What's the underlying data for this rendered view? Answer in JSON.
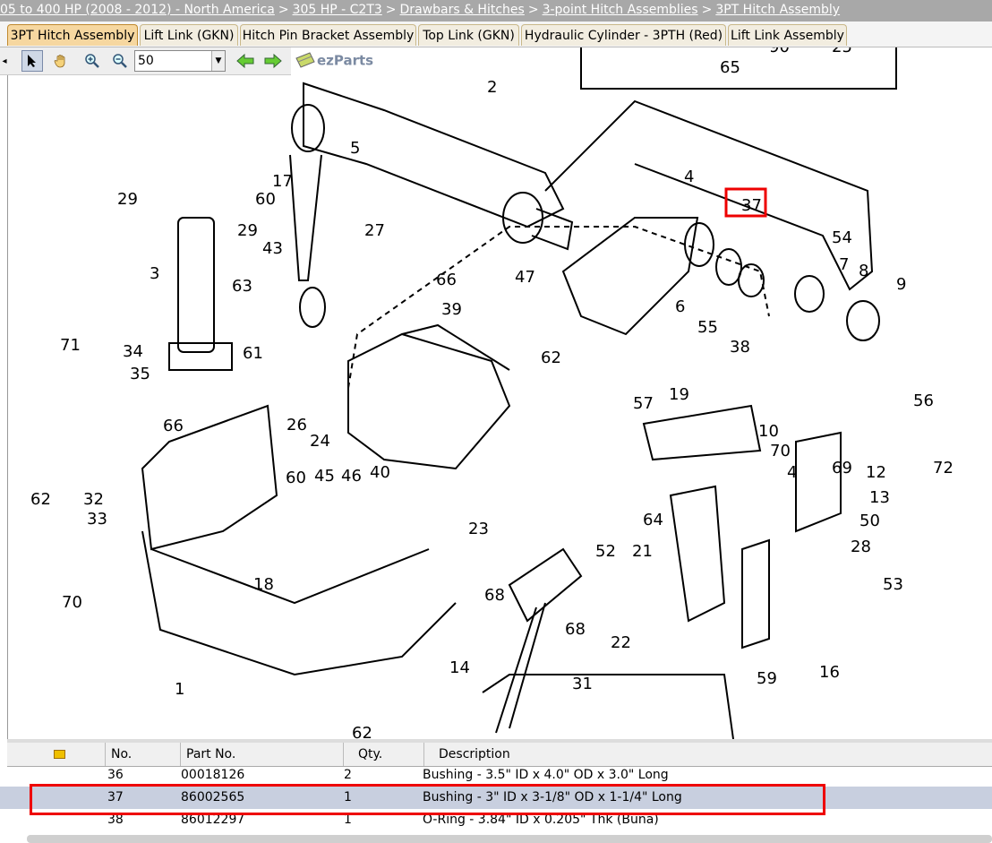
{
  "breadcrumb": [
    "05 to 400 HP (2008 - 2012) - North America",
    "305 HP - C2T3",
    "Drawbars & Hitches",
    "3-point Hitch Assemblies",
    "3PT Hitch Assembly"
  ],
  "breadcrumb_sep": ">",
  "tabs": [
    "3PT Hitch Assembly",
    "Lift Link (GKN)",
    "Hitch Pin Bracket Assembly",
    "Top Link (GKN)",
    "Hydraulic Cylinder - 3PTH (Red)",
    "Lift Link Assembly"
  ],
  "active_tab": "3PT Hitch Assembly",
  "toolbar": {
    "zoom": "50",
    "logo_text": "ezParts"
  },
  "icons": [
    "pointer-icon",
    "pan-hand-icon",
    "zoom-in-icon",
    "zoom-out-icon",
    "back-arrow-icon",
    "forward-arrow-icon",
    "note-icon"
  ],
  "callouts": [
    "65",
    "90",
    "25",
    "2",
    "5",
    "4",
    "37",
    "17",
    "60",
    "29",
    "29",
    "27",
    "43",
    "3",
    "63",
    "66",
    "47",
    "39",
    "54",
    "7",
    "8",
    "9",
    "6",
    "55",
    "38",
    "62",
    "71",
    "34",
    "35",
    "61",
    "26",
    "24",
    "19",
    "10",
    "56",
    "70",
    "4",
    "69",
    "57",
    "72",
    "66",
    "12",
    "13",
    "50",
    "62",
    "32",
    "33",
    "60",
    "45",
    "46",
    "40",
    "23",
    "64",
    "28",
    "53",
    "18",
    "70",
    "52",
    "21",
    "68",
    "68",
    "22",
    "59",
    "16",
    "1",
    "14",
    "31",
    "62"
  ],
  "highlight_callout": "37",
  "parts_table": {
    "headers": [
      "",
      "No.",
      "Part No.",
      "Qty.",
      "Description"
    ],
    "rows": [
      {
        "no": "36",
        "part": "00018126",
        "qty": "2",
        "desc": "Bushing - 3.5\" ID x 4.0\" OD x 3.0\" Long"
      },
      {
        "no": "37",
        "part": "86002565",
        "qty": "1",
        "desc": "Bushing - 3\" ID x 3-1/8\" OD x 1-1/4\" Long"
      },
      {
        "no": "38",
        "part": "86012297",
        "qty": "1",
        "desc": "O-Ring - 3.84\" ID x 0.205\" Thk (Buna)"
      }
    ],
    "selected_row": "37"
  },
  "colors": {
    "highlight": "#e00000",
    "selected_row": "#c8cfdf",
    "active_tab": "#f6d7a0",
    "breadcrumb_bg": "#a8a8a8"
  }
}
